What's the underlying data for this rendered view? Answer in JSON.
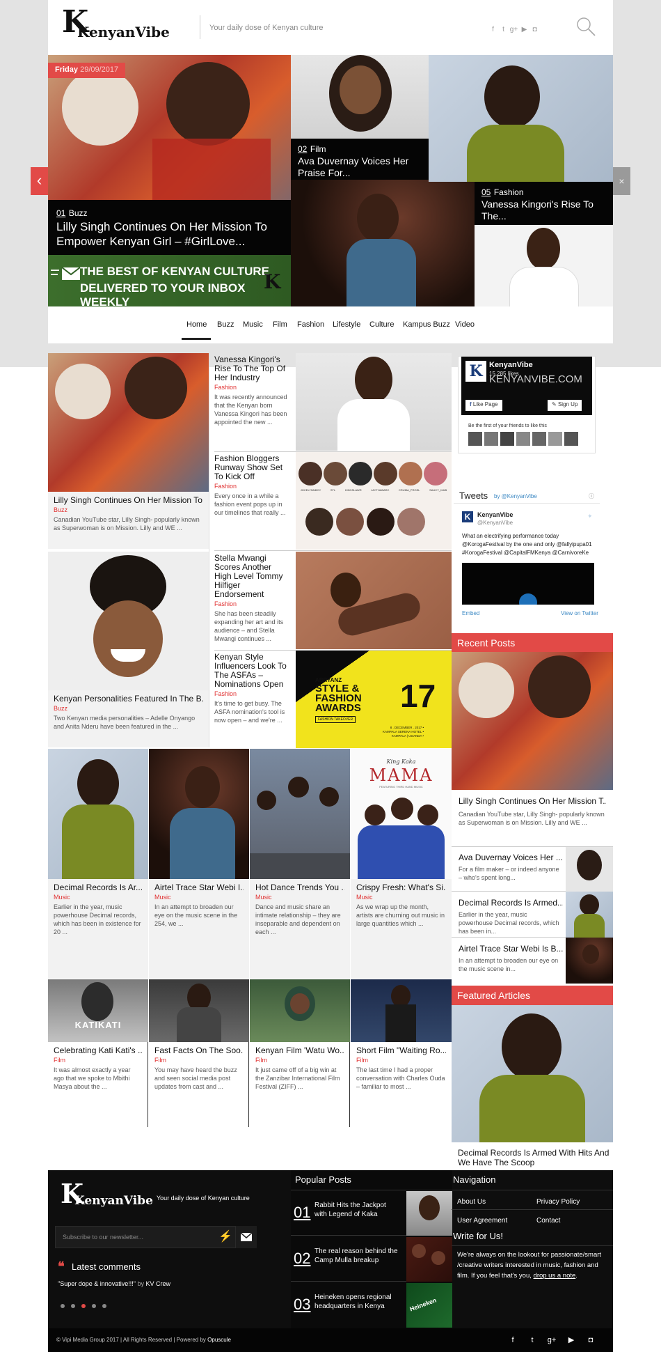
{
  "header": {
    "logo_text": "KenyanVibe",
    "logo_mark": "K",
    "tagline": "Your daily dose of Kenyan culture",
    "social_icons": [
      "facebook-icon",
      "twitter-icon",
      "google-plus-icon",
      "youtube-icon",
      "instagram-icon"
    ],
    "social_glyphs": [
      "f",
      "t",
      "g+",
      "▶",
      "◘"
    ]
  },
  "slider": {
    "date_day": "Friday",
    "date": "29/09/2017",
    "prev_glyph": "‹",
    "close_glyph": "×",
    "items": [
      {
        "num": "01",
        "category": "Buzz",
        "title": "Lilly Singh Continues On Her Mission To Empower Kenyan Girl – #GirlLove..."
      },
      {
        "num": "02",
        "category": "Film",
        "title": "Ava Duvernay Voices Her Praise For..."
      },
      {
        "num": "05",
        "category": "Fashion",
        "title": "Vanessa Kingori's Rise To The..."
      }
    ],
    "newsletter_banner": {
      "line1": "THE BEST OF KENYAN CULTURE",
      "line2": "DELIVERED TO YOUR INBOX WEEKLY"
    }
  },
  "nav": {
    "items": [
      "Home",
      "Buzz",
      "Music",
      "Film",
      "Fashion",
      "Lifestyle",
      "Culture",
      "Kampus Buzz",
      "Video"
    ],
    "active": "Home"
  },
  "featured_left": [
    {
      "title": "Lilly Singh Continues On Her Mission To...",
      "category": "Buzz",
      "excerpt": "Canadian YouTube star, Lilly Singh- popularly known as Superwoman is on Mission. Lilly and WE ..."
    },
    {
      "title": "Kenyan Personalities Featured In The B...",
      "category": "Buzz",
      "excerpt": "Two Kenyan media personalities – Adelle Onyango and Anita Nderu have been featured in the ..."
    }
  ],
  "list_posts": [
    {
      "title": "Vanessa Kingori's Rise To The Top Of Her Industry",
      "category": "Fashion",
      "excerpt": "It was recently announced that the Kenyan born Vanessa Kingori has been appointed the new ..."
    },
    {
      "title": "Fashion Bloggers Runway Show Set To Kick Off",
      "category": "Fashion",
      "excerpt": "Every once in a while a fashion event pops up in our timelines that really ..."
    },
    {
      "title": "Stella Mwangi Scores Another High Level Tommy Hilfiger Endorsement",
      "category": "Fashion",
      "excerpt": "She has been steadily expanding her art and its audience – and Stella Mwangi continues ..."
    },
    {
      "title": "Kenyan Style Influencers Look To The ASFAs – Nominations Open",
      "category": "Fashion",
      "excerpt": "It's time to get busy. The ASFA nomination's tool is now open – and we're ..."
    }
  ],
  "blogger_names": [
    "JOCELYNNBOY",
    "STL",
    "KINGSLAWR",
    "JAYTHABARC",
    "CRUMA_PROSL",
    "SAUCY_KAIB"
  ],
  "asfa": {
    "brand": "ABRYANZ",
    "line1": "STYLE &",
    "line2": "FASHION",
    "line3": "AWARDS",
    "year": "17",
    "tag": "FASHION TAKEOVER",
    "date": "8 . DECEMBER . 2017 •",
    "venue": "KAMPALA SERENA HOTEL •",
    "place": "KAMPALA | UGANDA •"
  },
  "music_posts": [
    {
      "title": "Decimal Records Is Ar...",
      "category": "Music",
      "excerpt": "Earlier in the year, music powerhouse Decimal records, which has been in existence for 20 ..."
    },
    {
      "title": "Airtel Trace Star Webi I...",
      "category": "Music",
      "excerpt": "In an attempt to broaden our eye on the music scene in the 254, we ..."
    },
    {
      "title": "Hot Dance Trends You ...",
      "category": "Music",
      "excerpt": "Dance and music share an intimate relationship – they are inseparable and dependent on each ..."
    },
    {
      "title": "Crispy Fresh: What's Si...",
      "category": "Music",
      "excerpt": "As we wrap up the month, artists are churning out music in large quantities which ..."
    }
  ],
  "mama": {
    "brand": "King Kaka",
    "title": "MAMA",
    "sub": "FEATURING THIRD HAND MUSIC"
  },
  "film_posts": [
    {
      "title": "Celebrating Kati Kati's ...",
      "category": "Film",
      "excerpt": "It was almost exactly a year ago that we spoke to Mbithi Masya about the ..."
    },
    {
      "title": "Fast Facts On The Soo...",
      "category": "Film",
      "excerpt": "You may have heard the buzz and seen social media post updates from cast and ..."
    },
    {
      "title": "Kenyan Film 'Watu Wo...",
      "category": "Film",
      "excerpt": "It just came off of a big win at the Zanzibar International Film Festival (ZIFF) ..."
    },
    {
      "title": "Short Film \"Waiting Ro...",
      "category": "Film",
      "excerpt": "The last time I had a proper conversation with Charles Ouda – familiar to most ..."
    }
  ],
  "katikati_label": "KATIKATI",
  "sidebar": {
    "fb": {
      "name": "KenyanVibe",
      "likes": "15,285 likes",
      "site": "KENYANVIBE.COM",
      "like_btn": "Like Page",
      "signup_btn": "Sign Up",
      "friends": "Be the first of your friends to like this"
    },
    "tweets": {
      "header": "Tweets",
      "by": "by @KenyanVibe",
      "name": "KenyanVibe",
      "handle": "@KenyanVibe",
      "text": "What an electrifying performance today @KorogaFestival by the one and only @fallyipupa01 #KorogaFestival @CapitalFMKenya @CarnivoreKe",
      "embed": "Embed",
      "view": "View on Twitter"
    },
    "recent_header": "Recent Posts",
    "recent_main": {
      "title": "Lilly Singh Continues On Her Mission T...",
      "excerpt": "Canadian YouTube star, Lilly Singh- popularly known as Superwoman is on Mission. Lilly and WE ..."
    },
    "recent_list": [
      {
        "title": "Ava Duvernay Voices Her ...",
        "excerpt": "For a film maker – or indeed anyone – who's spent long..."
      },
      {
        "title": "Decimal Records Is Armed...",
        "excerpt": "Earlier in the year, music powerhouse Decimal records, which has been in..."
      },
      {
        "title": "Airtel Trace Star Webi Is B...",
        "excerpt": "In an attempt to broaden our eye on the music scene in..."
      }
    ],
    "featured_header": "Featured Articles",
    "featured_title": "Decimal Records Is Armed With Hits And We Have The Scoop"
  },
  "footer": {
    "tagline": "Your daily dose of Kenyan culture",
    "newsletter_placeholder": "Subscribe to our newsletter...",
    "latest_comments": "Latest comments",
    "comment": "\"Super dope & innovative!!!\"",
    "comment_by": "by",
    "comment_author": "KV Crew",
    "popular_header": "Popular Posts",
    "popular": [
      {
        "num": "01",
        "title": "Rabbit Hits the Jackpot with Legend of Kaka"
      },
      {
        "num": "02",
        "title": "The real reason behind the Camp Mulla breakup"
      },
      {
        "num": "03",
        "title": "Heineken opens regional headquarters in Kenya"
      }
    ],
    "navigation_header": "Navigation",
    "nav_links": [
      "About Us",
      "Privacy Policy",
      "User Agreement",
      "Contact"
    ],
    "write_header": "Write for Us!",
    "write_text": "We're always on the lookout for passionate/smart /creative writers interested in music, fashion and film. If you feel that's you,",
    "write_link": "drop us a note",
    "copyright": "© Vipi Media Group 2017 | All Rights Reserved | Powered by",
    "powered": "Opuscule",
    "heineken": "Heineken"
  },
  "colors": {
    "accent": "#e24a47",
    "category": "#e02e2e",
    "dark": "#0e0e0e",
    "green": "#2f5f24",
    "yellow": "#f1e31c"
  }
}
